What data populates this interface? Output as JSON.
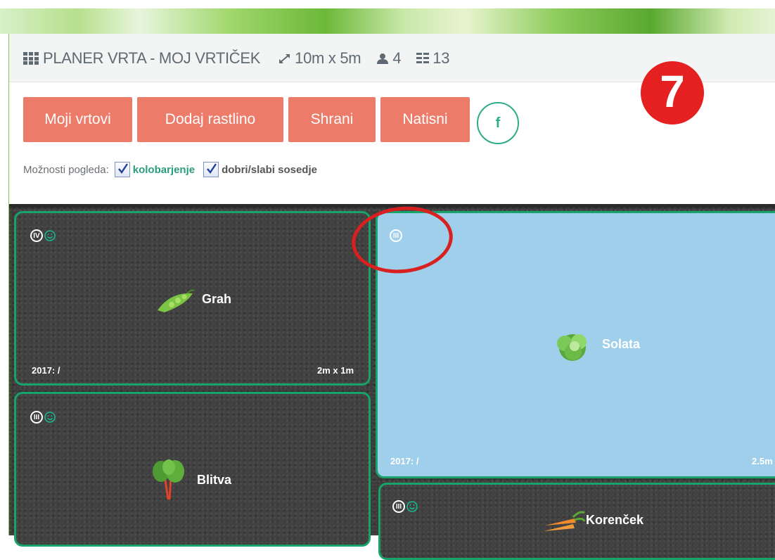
{
  "header": {
    "title": "PLANER VRTA - MOJ VRTIČEK",
    "size": "10m x 5m",
    "people": "4",
    "beds_count": "13"
  },
  "badge": "7",
  "toolbar": {
    "buttons": [
      "Moji vrtovi",
      "Dodaj rastlino",
      "Shrani",
      "Natisni"
    ],
    "facebook": "f"
  },
  "view_options": {
    "label": "Možnosti pogleda:",
    "option1": "kolobarjenje",
    "option2": "dobri/slabi sosedje"
  },
  "beds": [
    {
      "roman": "IV",
      "plant": "Grah",
      "year": "2017: /",
      "size": "2m x 1m"
    },
    {
      "roman": "III",
      "plant": "Solata",
      "year": "2017: /",
      "size": "2.5m"
    },
    {
      "roman": "III",
      "plant": "Blitva"
    },
    {
      "roman": "III",
      "plant": "Korenček"
    }
  ],
  "colors": {
    "accent_button": "#ec7b69",
    "bed_border": "#17a36a",
    "highlight_bed": "#9fcfeb",
    "annotation_red": "#e42020"
  }
}
